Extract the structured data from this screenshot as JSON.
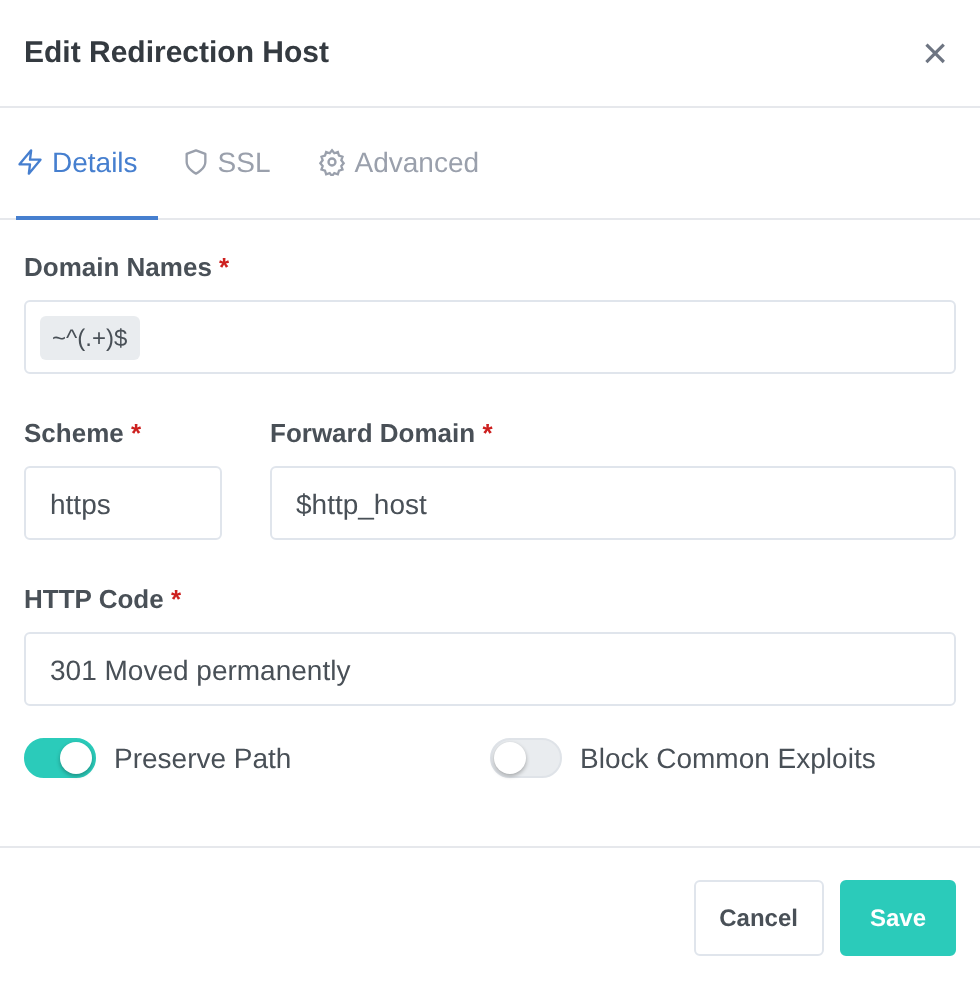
{
  "dialog": {
    "title": "Edit Redirection Host",
    "close": "×"
  },
  "tabs": [
    {
      "label": "Details",
      "kind": "bolt",
      "selected": true
    },
    {
      "label": "SSL",
      "kind": "shield",
      "selected": false
    },
    {
      "label": "Advanced",
      "kind": "gear",
      "selected": false
    }
  ],
  "domain_names": {
    "label": "Domain Names",
    "required_mark": "*",
    "tags": [
      "~^(.+)$"
    ]
  },
  "scheme": {
    "label": "Scheme",
    "required_mark": "*",
    "value": "https"
  },
  "forward_domain": {
    "label": "Forward Domain",
    "required_mark": "*",
    "value": "$http_host"
  },
  "http_code": {
    "label": "HTTP Code",
    "required_mark": "*",
    "value": "301 Moved permanently"
  },
  "toggles": [
    {
      "label": "Preserve Path",
      "on": true
    },
    {
      "label": "Block Common Exploits",
      "on": false
    }
  ],
  "buttons": [
    {
      "label": "Cancel",
      "kind": "secondary"
    },
    {
      "label": "Save",
      "kind": "primary"
    }
  ]
}
